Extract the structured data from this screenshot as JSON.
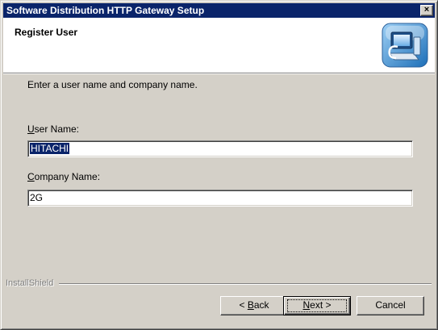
{
  "window": {
    "title": "Software Distribution HTTP Gateway Setup",
    "close_label": "×"
  },
  "header": {
    "title": "Register User",
    "icon": "setup-computer-icon"
  },
  "form": {
    "instruction": "Enter a user name and company name.",
    "user_name": {
      "label_accel": "U",
      "label_rest": "ser Name:",
      "value": "HITACHI",
      "selected": true
    },
    "company_name": {
      "label_accel": "C",
      "label_rest": "ompany Name:",
      "value": "2G"
    }
  },
  "footer": {
    "brand": "InstallShield",
    "back": {
      "prefix": "< ",
      "accel": "B",
      "rest": "ack"
    },
    "next": {
      "accel": "N",
      "rest": "ext >"
    },
    "cancel": "Cancel"
  },
  "colors": {
    "title_bar": "#0a246a",
    "dialog_face": "#d4d0c8",
    "selection": "#0a246a"
  }
}
